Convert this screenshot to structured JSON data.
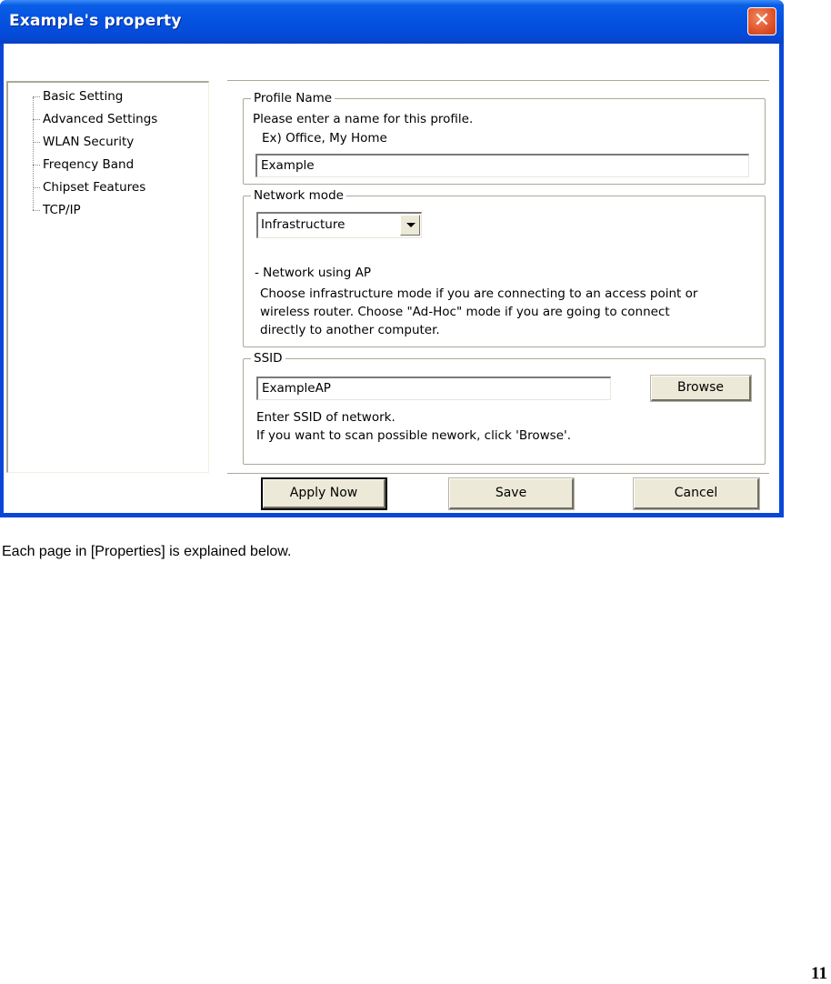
{
  "window": {
    "title": "Example's property",
    "close_label": "✕"
  },
  "tree": {
    "items": [
      {
        "label": "Basic Setting"
      },
      {
        "label": "Advanced Settings"
      },
      {
        "label": "WLAN Security"
      },
      {
        "label": "Freqency Band"
      },
      {
        "label": "Chipset Features"
      },
      {
        "label": "TCP/IP"
      }
    ]
  },
  "profile": {
    "legend": "Profile Name",
    "instruction": "Please enter a name for this profile.",
    "example": "Ex) Office, My Home",
    "value": "Example"
  },
  "network_mode": {
    "legend": "Network mode",
    "selected": "Infrastructure",
    "heading": "- Network using AP",
    "desc_lines": [
      "Choose infrastructure mode if you are connecting to an access point or",
      "wireless router. Choose \"Ad-Hoc\" mode if you are going to connect",
      "directly to another computer."
    ]
  },
  "ssid": {
    "legend": "SSID",
    "value": "ExampleAP",
    "browse_label": "Browse",
    "help_lines": [
      "Enter SSID of network.",
      "If you want to scan possible nework, click 'Browse'."
    ]
  },
  "buttons": {
    "apply": "Apply Now",
    "save": "Save",
    "cancel": "Cancel"
  },
  "document": {
    "caption": "Each page in [Properties] is explained below.",
    "page_number": "11"
  }
}
